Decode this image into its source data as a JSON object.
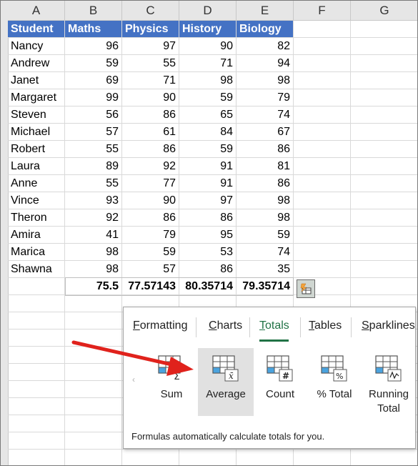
{
  "column_headers": [
    "A",
    "B",
    "C",
    "D",
    "E",
    "F",
    "G"
  ],
  "table": {
    "headers": [
      "Student",
      "Maths",
      "Physics",
      "History",
      "Biology"
    ],
    "rows": [
      [
        "Nancy",
        "96",
        "97",
        "90",
        "82"
      ],
      [
        "Andrew",
        "59",
        "55",
        "71",
        "94"
      ],
      [
        "Janet",
        "69",
        "71",
        "98",
        "98"
      ],
      [
        "Margaret",
        "99",
        "90",
        "59",
        "79"
      ],
      [
        "Steven",
        "56",
        "86",
        "65",
        "74"
      ],
      [
        "Michael",
        "57",
        "61",
        "84",
        "67"
      ],
      [
        "Robert",
        "55",
        "86",
        "59",
        "86"
      ],
      [
        "Laura",
        "89",
        "92",
        "91",
        "81"
      ],
      [
        "Anne",
        "55",
        "77",
        "91",
        "86"
      ],
      [
        "Vince",
        "93",
        "90",
        "97",
        "98"
      ],
      [
        "Theron",
        "92",
        "86",
        "86",
        "98"
      ],
      [
        "Amira",
        "41",
        "79",
        "95",
        "59"
      ],
      [
        "Marica",
        "98",
        "59",
        "53",
        "74"
      ],
      [
        "Shawna",
        "98",
        "57",
        "86",
        "35"
      ]
    ],
    "totals": [
      "75.5",
      "77.57143",
      "80.35714",
      "79.35714"
    ],
    "header_color": "#4472c4"
  },
  "quick_analysis": {
    "button_icon": "quick-analysis-icon",
    "tabs": [
      "Formatting",
      "Charts",
      "Totals",
      "Tables",
      "Sparklines"
    ],
    "tab_mnemonics": [
      "F",
      "C",
      "T",
      "T",
      "S"
    ],
    "active_tab": "Totals",
    "accent_color": "#217346",
    "items": [
      {
        "label": "Sum",
        "icon": "sum-icon"
      },
      {
        "label": "Average",
        "icon": "average-icon"
      },
      {
        "label": "Count",
        "icon": "count-icon"
      },
      {
        "label": "% Total",
        "icon": "percent-total-icon"
      },
      {
        "label": "Running Total",
        "label_line1": "Running",
        "label_line2": "Total",
        "icon": "running-total-icon"
      }
    ],
    "hovered_item": "Average",
    "footer": "Formulas automatically calculate totals for you."
  },
  "annotation": {
    "color": "#e0221c",
    "points_to": "Average"
  }
}
